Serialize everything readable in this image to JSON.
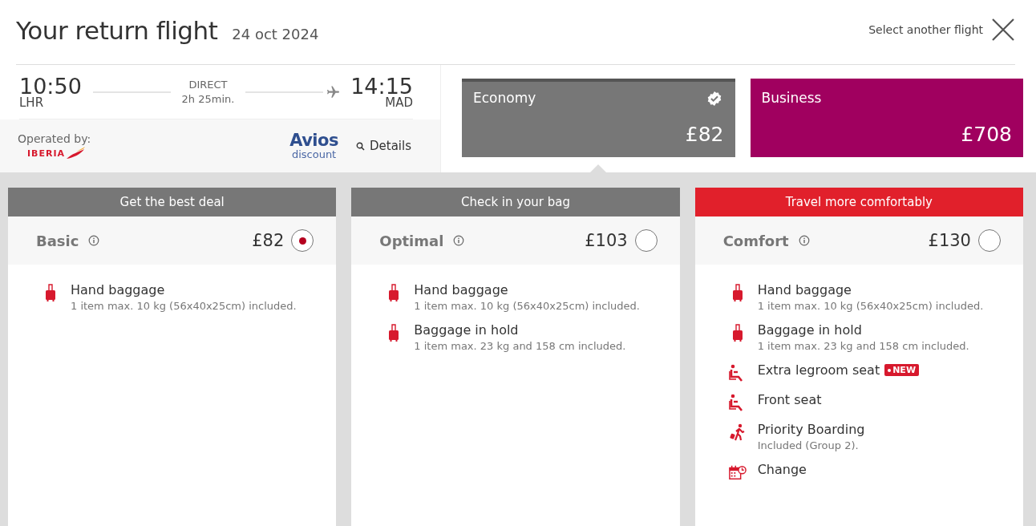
{
  "header": {
    "title": "Your return flight",
    "date": "24 oct 2024",
    "close_label": "Select another flight"
  },
  "flight": {
    "depart_time": "10:50",
    "depart_airport": "LHR",
    "stops": "DIRECT",
    "duration": "2h 25min.",
    "arrive_time": "14:15",
    "arrive_airport": "MAD",
    "operated_label": "Operated by:",
    "airline": "IBERIA",
    "avios": "Avios",
    "avios_sub": "discount",
    "details": "Details"
  },
  "cabins": [
    {
      "name": "Economy",
      "price": "£82",
      "selected": true,
      "color": "#777777"
    },
    {
      "name": "Business",
      "price": "£708",
      "selected": false,
      "color": "#a0005f"
    }
  ],
  "fares": [
    {
      "banner": "Get the best deal",
      "color": "#777777",
      "name": "Basic",
      "price": "£82",
      "selected": true,
      "features": [
        {
          "kind": "suitcase",
          "title": "Hand baggage",
          "detail": "1 item max. 10 kg (56x40x25cm) included."
        }
      ]
    },
    {
      "banner": "Check in your bag",
      "color": "#777777",
      "name": "Optimal",
      "price": "£103",
      "selected": false,
      "features": [
        {
          "kind": "suitcase",
          "title": "Hand baggage",
          "detail": "1 item max. 10 kg (56x40x25cm) included."
        },
        {
          "kind": "suitcase",
          "title": "Baggage in hold",
          "detail": "1 item max. 23 kg and 158 cm included."
        }
      ]
    },
    {
      "banner": "Travel more comfortably",
      "color": "#e1202b",
      "name": "Comfort",
      "price": "£130",
      "selected": false,
      "features": [
        {
          "kind": "suitcase",
          "title": "Hand baggage",
          "detail": "1 item max. 10 kg (56x40x25cm) included."
        },
        {
          "kind": "suitcase",
          "title": "Baggage in hold",
          "detail": "1 item max. 23 kg and 158 cm included."
        },
        {
          "kind": "seat",
          "title": "Extra legroom seat",
          "badge": "NEW"
        },
        {
          "kind": "seat",
          "title": "Front seat"
        },
        {
          "kind": "boarding",
          "title": "Priority Boarding",
          "detail": "Included (Group 2)."
        },
        {
          "kind": "change",
          "title": "Change"
        }
      ]
    }
  ]
}
